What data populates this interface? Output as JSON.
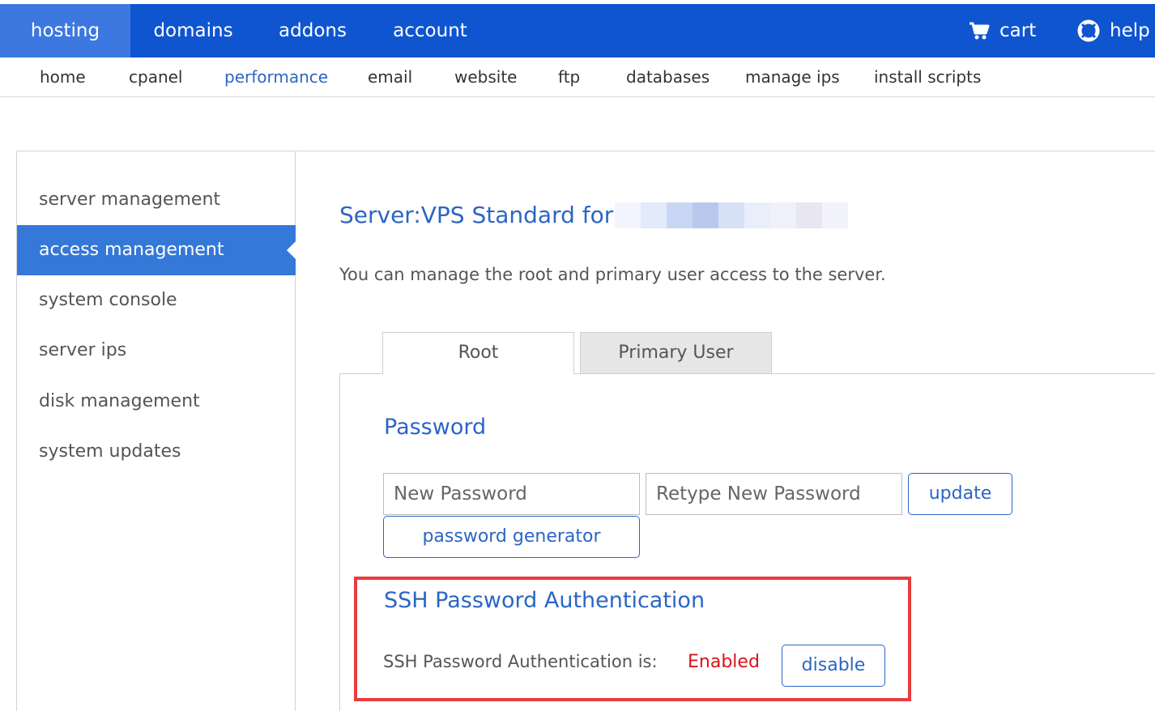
{
  "topnav": {
    "tabs": [
      {
        "label": "hosting",
        "active": true
      },
      {
        "label": "domains",
        "active": false
      },
      {
        "label": "addons",
        "active": false
      },
      {
        "label": "account",
        "active": false
      }
    ],
    "cart_label": "cart",
    "help_label": "help",
    "cart_icon": "cart-icon",
    "help_icon": "lifebuoy-icon"
  },
  "subnav": {
    "items": [
      {
        "label": "home",
        "active": false
      },
      {
        "label": "cpanel",
        "active": false
      },
      {
        "label": "performance",
        "active": true
      },
      {
        "label": "email",
        "active": false
      },
      {
        "label": "website",
        "active": false
      },
      {
        "label": "ftp",
        "active": false
      },
      {
        "label": "databases",
        "active": false
      },
      {
        "label": "manage ips",
        "active": false
      },
      {
        "label": "install scripts",
        "active": false
      }
    ]
  },
  "sidebar": {
    "items": [
      {
        "label": "server management",
        "active": false
      },
      {
        "label": "access management",
        "active": true
      },
      {
        "label": "system console",
        "active": false
      },
      {
        "label": "server ips",
        "active": false
      },
      {
        "label": "disk management",
        "active": false
      },
      {
        "label": "system updates",
        "active": false
      }
    ]
  },
  "main": {
    "server_title": "Server:VPS Standard for",
    "intro": "You can manage the root and primary user access to the server.",
    "tabs": [
      {
        "label": "Root",
        "active": true
      },
      {
        "label": "Primary User",
        "active": false
      }
    ],
    "password": {
      "heading": "Password",
      "new_password_placeholder": "New Password",
      "new_password_value": "",
      "retype_placeholder": "Retype New Password",
      "retype_value": "",
      "update_label": "update",
      "generator_label": "password generator"
    },
    "ssh": {
      "heading": "SSH Password Authentication",
      "status_label": "SSH Password Authentication is:",
      "status_value": "Enabled",
      "disable_label": "disable"
    }
  },
  "colors": {
    "nav_blue": "#0f55d0",
    "nav_active": "#3c78e0",
    "link_blue": "#2b66c4",
    "sidebar_active": "#3478d8",
    "status_red": "#d9141b",
    "highlight_red": "#e83c3f"
  }
}
